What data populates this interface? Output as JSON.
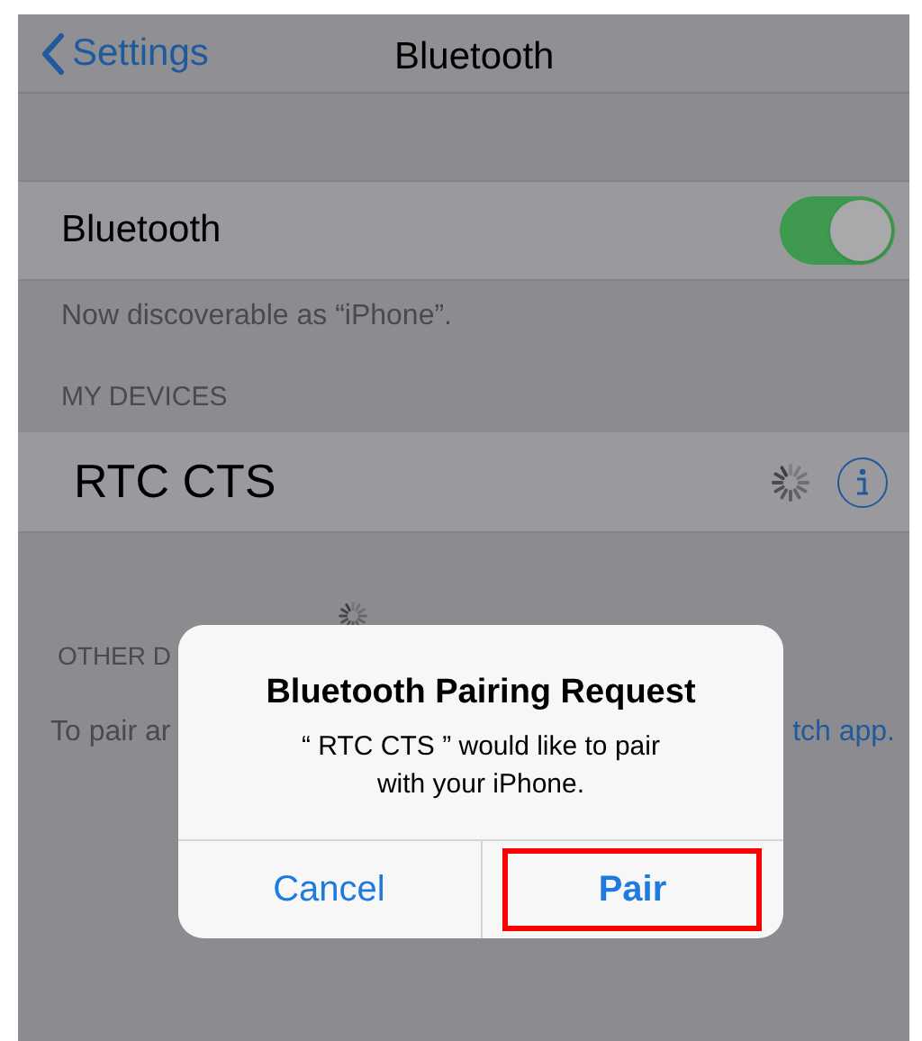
{
  "nav": {
    "back": "Settings",
    "title": "Bluetooth"
  },
  "bluetooth_row": {
    "label": "Bluetooth",
    "on": true
  },
  "discoverable_note": "Now discoverable as “iPhone”.",
  "my_devices": {
    "header": "MY DEVICES",
    "items": [
      {
        "name": "RTC CTS",
        "connecting": true
      }
    ]
  },
  "other_devices": {
    "header": "OTHER D",
    "searching": true,
    "note_left": "To pair ar",
    "note_right": "tch app."
  },
  "alert": {
    "title": "Bluetooth Pairing Request",
    "message_lines": [
      "“  RTC CTS ” would like to pair",
      "with your iPhone."
    ],
    "buttons": [
      {
        "label": "Cancel",
        "highlighted": false
      },
      {
        "label": "Pair",
        "highlighted": true
      }
    ]
  }
}
